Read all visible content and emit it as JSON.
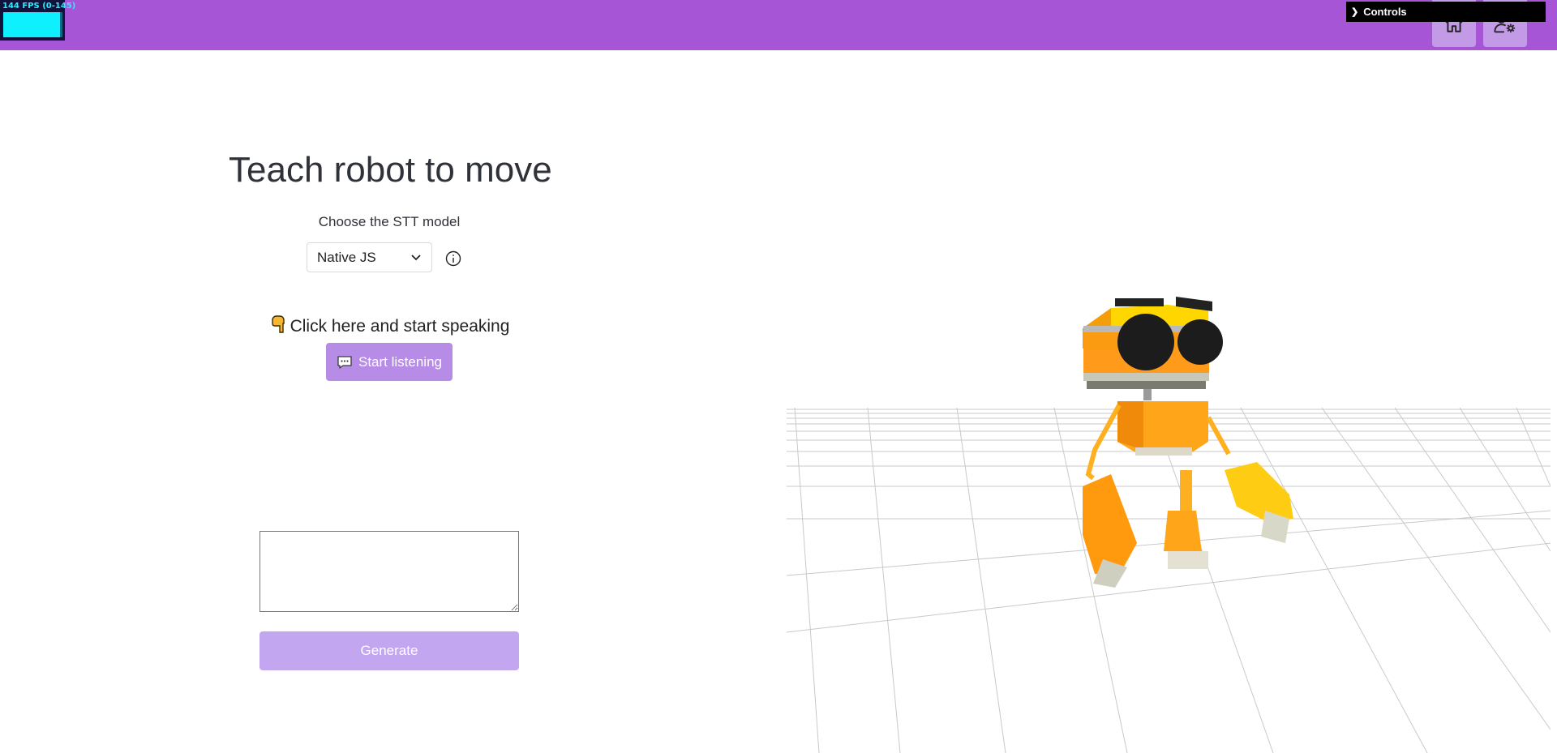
{
  "fps_meter": {
    "label": "144 FPS (0-145)"
  },
  "header": {
    "color": "#a655d6",
    "home_icon": "home-icon",
    "user_settings_icon": "user-gear-icon"
  },
  "controls_panel": {
    "label": "Controls",
    "icon": "chevron-right-icon"
  },
  "main": {
    "title": "Teach robot to move",
    "stt_label": "Choose the STT model",
    "stt_select": {
      "value": "Native JS",
      "icon": "chevron-down-icon"
    },
    "info_icon": "info-circle-icon",
    "hint": "Click here and start speaking",
    "hint_icon": "pointing-hand-icon",
    "listen_button": {
      "label": "Start listening",
      "icon": "speech-bubble-icon",
      "color": "#b68ce6"
    },
    "prompt_textarea": {
      "value": ""
    },
    "generate_button": {
      "label": "Generate",
      "color": "#c2a6ef"
    }
  },
  "scene": {
    "content": "robot-3d-model"
  }
}
